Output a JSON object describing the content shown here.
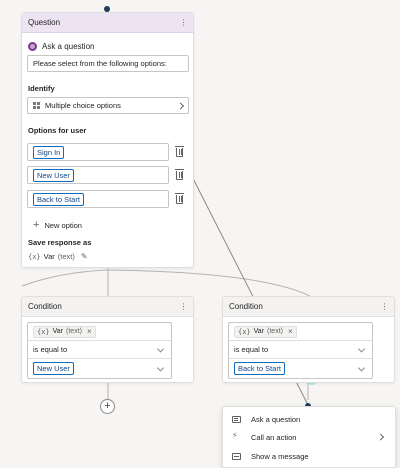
{
  "question_node": {
    "header": "Question",
    "title": "Ask a question",
    "prompt_text": "Please select from the following options:",
    "identify_label": "Identify",
    "identify_value": "Multiple choice options",
    "options_label": "Options for user",
    "options": [
      "Sign In",
      "New User",
      "Back to Start"
    ],
    "new_option_label": "New option",
    "save_label": "Save response as",
    "var_badge": "{x}",
    "var_name": "Var",
    "var_type": "(text)"
  },
  "conditions": [
    {
      "header": "Condition",
      "var_badge": "{x}",
      "var_name": "Var",
      "var_type": "(text)",
      "operator": "is equal to",
      "value": "New User"
    },
    {
      "header": "Condition",
      "var_badge": "{x}",
      "var_name": "Var",
      "var_type": "(text)",
      "operator": "is equal to",
      "value": "Back to Start"
    }
  ],
  "add_node_label": "+",
  "menu": {
    "items": [
      "Ask a question",
      "Call an action",
      "Show a message"
    ]
  },
  "colors": {
    "canvas": "#f6f5f3",
    "question_header": "#ece4f2",
    "chip_border": "#0f6cbd",
    "annotation_arrow": "#e3101b",
    "connector_dot": "#1f3b5c"
  }
}
